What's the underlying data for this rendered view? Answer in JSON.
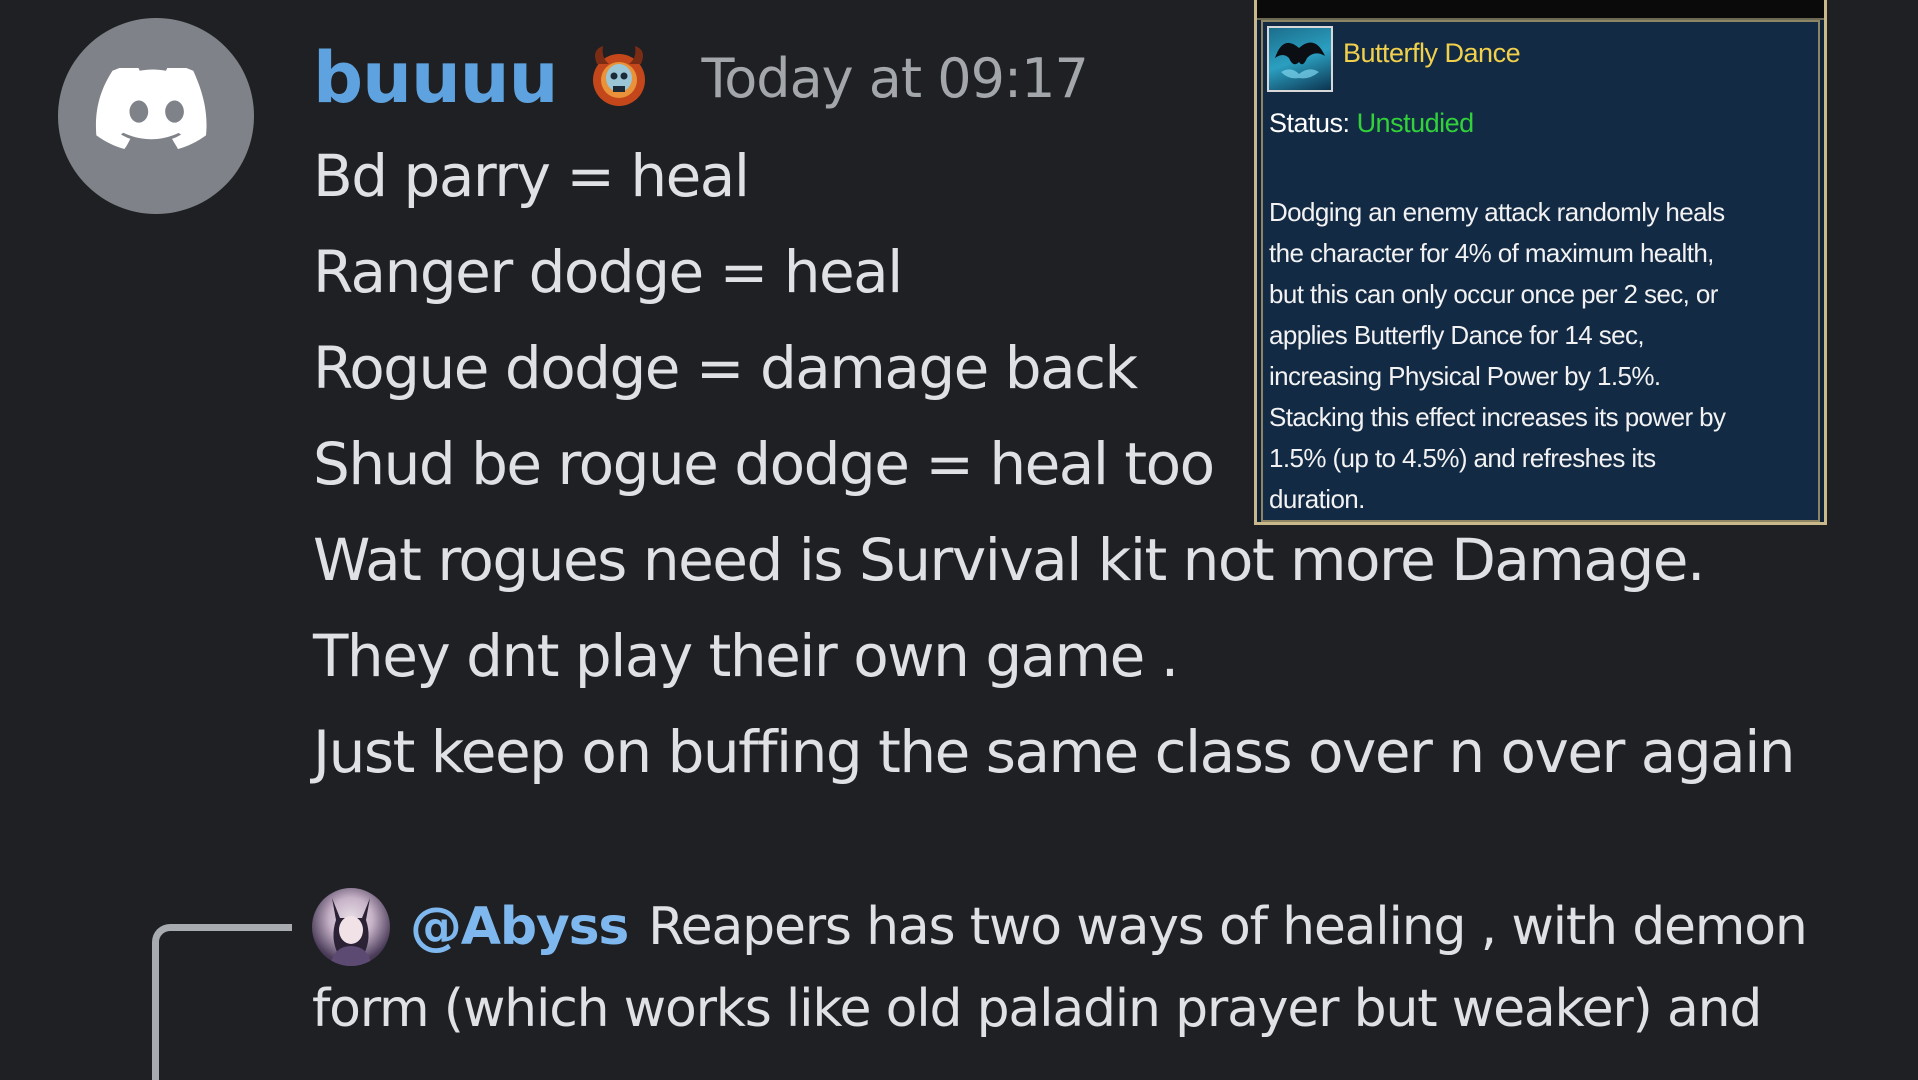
{
  "message": {
    "author": "buuuu",
    "timestamp": "Today at 09:17",
    "avatar_icon": "discord-logo-icon",
    "role_icon": "horned-skull-icon",
    "username_color": "#5ea3e0",
    "lines": [
      "Bd parry  = heal",
      "Ranger dodge = heal",
      "Rogue dodge = damage back",
      "Shud be rogue dodge = heal too",
      "Wat rogues need is Survival kit not more Damage.",
      "They dnt play their own game .",
      "Just keep on buffing the same class over n over again"
    ]
  },
  "tooltip": {
    "skill_name": "Butterfly Dance",
    "status_label": "Status:",
    "status_value": "Unstudied",
    "status_color": "#32d13a",
    "name_color": "#f1d04b",
    "description_lines": [
      "Dodging an enemy attack randomly heals",
      "the character for 4% of maximum health,",
      "but this can only occur once per 2 sec, or",
      "applies Butterfly Dance for 14 sec,",
      "increasing Physical Power by 1.5%.",
      "Stacking this effect increases its power by",
      "1.5% (up to 4.5%) and refreshes its",
      "duration."
    ]
  },
  "reply": {
    "mention": "@Abyss",
    "line1": "Reapers has two ways of healing ,  with demon",
    "line2": "form (which works like old paladin prayer but weaker) and",
    "mention_color": "#7fb8ef"
  }
}
